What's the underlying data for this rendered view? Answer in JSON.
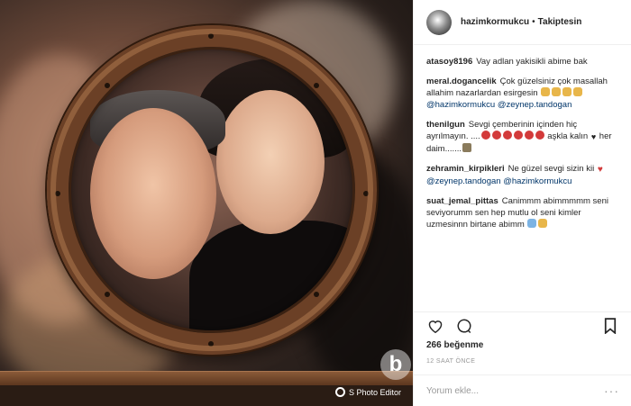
{
  "post": {
    "username": "hazimkormukcu",
    "separator": "•",
    "follow_status": "Takiptesin"
  },
  "comments": [
    {
      "user": "atasoy8196",
      "parts": [
        {
          "t": "Vay adlan yakisikli abime bak"
        }
      ]
    },
    {
      "user": "meral.dogancelik",
      "parts": [
        {
          "t": "Çok güzelsiniz çok masallah allahim nazarlardan esirgesin "
        },
        {
          "emoji": "pray"
        },
        {
          "emoji": "pray"
        },
        {
          "emoji": "pray"
        },
        {
          "emoji": "pray"
        },
        {
          "t": " "
        },
        {
          "m": "@hazimkormukcu"
        },
        {
          "t": " "
        },
        {
          "m": "@zeynep.tandogan"
        }
      ]
    },
    {
      "user": "thenilgun",
      "parts": [
        {
          "t": "Sevgi çemberinin içinden hiç ayrılmayın. ...."
        },
        {
          "emoji": "balloon"
        },
        {
          "emoji": "balloon"
        },
        {
          "emoji": "balloon"
        },
        {
          "emoji": "balloon"
        },
        {
          "emoji": "balloon"
        },
        {
          "emoji": "balloon"
        },
        {
          "t": " aşkla kalın "
        },
        {
          "emoji": "heart"
        },
        {
          "t": " her daim......."
        },
        {
          "emoji": "bag"
        }
      ]
    },
    {
      "user": "zehramin_kirpikleri",
      "parts": [
        {
          "t": "Ne güzel sevgi sizin kii "
        },
        {
          "emoji": "rheart"
        },
        {
          "t": " "
        },
        {
          "m": "@zeynep.tandogan"
        },
        {
          "t": " "
        },
        {
          "m": "@hazimkormukcu"
        }
      ]
    },
    {
      "user": "suat_jemal_pittas",
      "parts": [
        {
          "t": "Canimmm abimmmmm seni seviyorumm sen hep mutlu ol seni kimler uzmesinnn birtane abimm "
        },
        {
          "emoji": "angel"
        },
        {
          "emoji": "pray"
        }
      ]
    }
  ],
  "likes": "266 beğenme",
  "time_ago": "12 SAAT ÖNCE",
  "comment_input": {
    "placeholder": "Yorum ekle...",
    "value": ""
  },
  "more_label": "···",
  "watermark": "S Photo Editor",
  "site_logo": "b",
  "icons": {
    "like": "heart-icon",
    "comment": "speech-bubble-icon",
    "save": "bookmark-icon"
  },
  "colors": {
    "mention": "#003569",
    "text": "#262626",
    "muted": "#999999"
  }
}
